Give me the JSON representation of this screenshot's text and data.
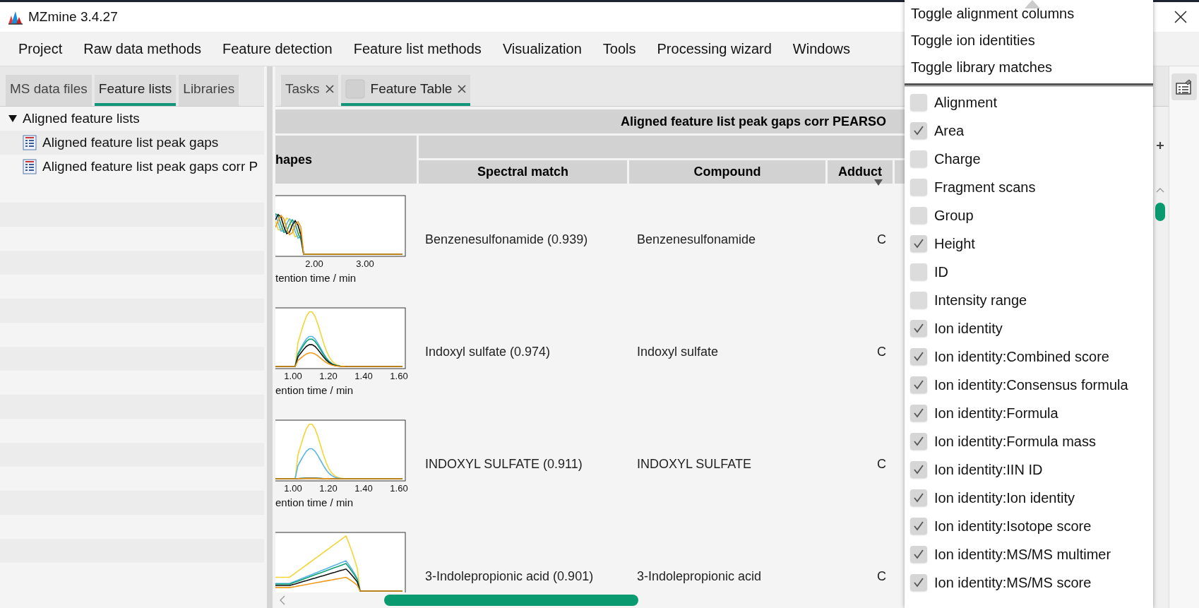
{
  "window": {
    "title": "MZmine 3.4.27"
  },
  "menu": [
    "Project",
    "Raw data methods",
    "Feature detection",
    "Feature list methods",
    "Visualization",
    "Tools",
    "Processing wizard",
    "Windows"
  ],
  "left_tabs": [
    {
      "label": "MS data files",
      "selected": false
    },
    {
      "label": "Feature lists",
      "selected": true
    },
    {
      "label": "Libraries",
      "selected": false
    }
  ],
  "tree": [
    {
      "label": "Aligned feature lists",
      "expanded": true,
      "children": [
        {
          "label": "Aligned feature list peak gaps"
        },
        {
          "label": "Aligned feature list peak gaps corr P"
        }
      ]
    }
  ],
  "right_tabs": [
    {
      "label": "Tasks",
      "selected": false,
      "has_icon": false
    },
    {
      "label": "Feature Table",
      "selected": true,
      "has_icon": true
    }
  ],
  "table": {
    "title": "Aligned feature list peak gaps corr PEARSO",
    "shapes_header": "hapes",
    "columns": [
      "Spectral match",
      "Compound",
      "Adduct"
    ],
    "rows": [
      {
        "ticks": [
          "2.00",
          "3.00"
        ],
        "axis_label": "tention time / min",
        "spectral_match": "Benzenesulfonamide (0.939)",
        "compound": "Benzenesulfonamide",
        "column_5": "C"
      },
      {
        "ticks": [
          "1.00",
          "1.20",
          "1.40",
          "1.60"
        ],
        "axis_label": "ention time / min",
        "spectral_match": "Indoxyl sulfate (0.974)",
        "compound": "Indoxyl sulfate",
        "column_5": "C"
      },
      {
        "ticks": [
          "1.00",
          "1.20",
          "1.40",
          "1.60"
        ],
        "axis_label": "ention time / min",
        "spectral_match": "INDOXYL SULFATE (0.911)",
        "compound": "INDOXYL SULFATE",
        "column_5": "C"
      },
      {
        "spectral_match": "3-Indolepropionic acid (0.901)",
        "compound": "3-Indolepropionic acid",
        "column_5": "C"
      }
    ]
  },
  "popup": {
    "actions": [
      "Toggle alignment columns",
      "Toggle ion identities",
      "Toggle library matches"
    ],
    "columns": [
      {
        "label": "Alignment",
        "checked": false
      },
      {
        "label": "Area",
        "checked": true
      },
      {
        "label": "Charge",
        "checked": false
      },
      {
        "label": "Fragment scans",
        "checked": false
      },
      {
        "label": "Group",
        "checked": false
      },
      {
        "label": "Height",
        "checked": true
      },
      {
        "label": "ID",
        "checked": false
      },
      {
        "label": "Intensity range",
        "checked": false
      },
      {
        "label": "Ion identity",
        "checked": true
      },
      {
        "label": "Ion identity:Combined score",
        "checked": true
      },
      {
        "label": "Ion identity:Consensus formula",
        "checked": true
      },
      {
        "label": "Ion identity:Formula",
        "checked": true
      },
      {
        "label": "Ion identity:Formula mass",
        "checked": true
      },
      {
        "label": "Ion identity:IIN ID",
        "checked": true
      },
      {
        "label": "Ion identity:Ion identity",
        "checked": true
      },
      {
        "label": "Ion identity:Isotope score",
        "checked": true
      },
      {
        "label": "Ion identity:MS/MS multimer",
        "checked": true
      },
      {
        "label": "Ion identity:MS/MS score",
        "checked": true
      }
    ]
  }
}
